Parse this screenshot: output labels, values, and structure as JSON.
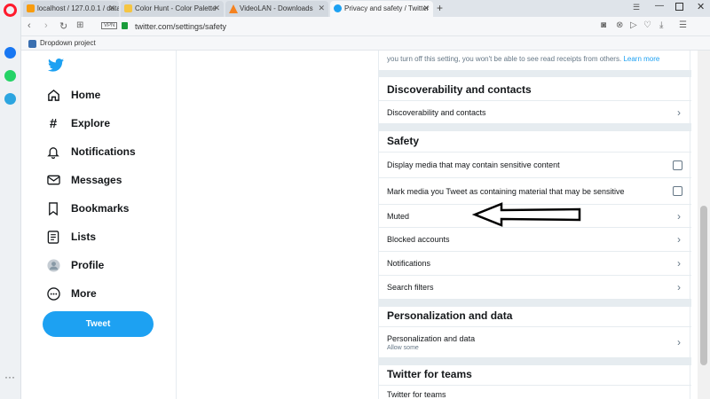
{
  "browser": {
    "tabs": [
      {
        "label": "localhost / 127.0.0.1 / data"
      },
      {
        "label": "Color Hunt - Color Palette"
      },
      {
        "label": "VideoLAN - Downloads"
      },
      {
        "label": "Privacy and safety / Twitter"
      }
    ],
    "new_tab": "+",
    "vpn_badge": "VPN",
    "url": "twitter.com/settings/safety",
    "bookmark": "Dropdown project"
  },
  "nav": {
    "items": [
      {
        "label": "Home",
        "icon": "home-icon"
      },
      {
        "label": "Explore",
        "icon": "hashtag-icon"
      },
      {
        "label": "Notifications",
        "icon": "bell-icon"
      },
      {
        "label": "Messages",
        "icon": "mail-icon"
      },
      {
        "label": "Bookmarks",
        "icon": "bookmark-icon"
      },
      {
        "label": "Lists",
        "icon": "list-icon"
      },
      {
        "label": "Profile",
        "icon": "avatar"
      },
      {
        "label": "More",
        "icon": "more-icon"
      }
    ],
    "tweet_button": "Tweet"
  },
  "settings": {
    "top_note": "you turn off this setting, you won't be able to see read receipts from others.",
    "top_note_link": "Learn more",
    "discoverability": {
      "heading": "Discoverability and contacts",
      "rows": [
        "Discoverability and contacts"
      ]
    },
    "safety": {
      "heading": "Safety",
      "check_rows": [
        "Display media that may contain sensitive content",
        "Mark media you Tweet as containing material that may be sensitive"
      ],
      "rows": [
        "Muted",
        "Blocked accounts",
        "Notifications",
        "Search filters"
      ]
    },
    "personalization": {
      "heading": "Personalization and data",
      "row": "Personalization and data",
      "row_sub": "Allow some"
    },
    "teams": {
      "heading": "Twitter for teams",
      "row": "Twitter for teams"
    }
  },
  "colors": {
    "twitter_blue": "#1da1f2",
    "opera_red": "#ff1b2d"
  }
}
